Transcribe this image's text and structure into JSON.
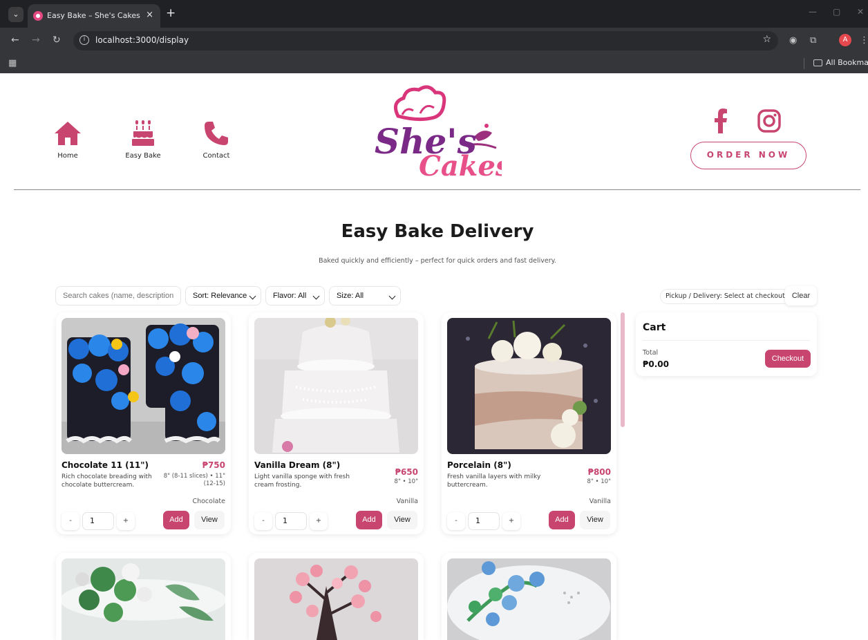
{
  "browser": {
    "tab_title": "Easy Bake – She's Cakes",
    "tab_close": "×",
    "new_tab": "+",
    "url": "localhost:3000/display",
    "profile_initial": "A",
    "bookmarks_label": "All Bookmarks"
  },
  "header": {
    "nav": [
      {
        "label": "Home",
        "icon": "house-icon"
      },
      {
        "label": "Easy Bake",
        "icon": "cake-icon"
      },
      {
        "label": "Contact",
        "icon": "phone-icon"
      }
    ],
    "logo_top": "She's",
    "logo_bottom": "Cakes",
    "order_button": "ORDER NOW",
    "brand_color": "#c8456f"
  },
  "page": {
    "title": "Easy Bake Delivery",
    "subtitle": "Baked quickly and efficiently – perfect for quick orders and fast delivery."
  },
  "controls": {
    "search_placeholder": "Search cakes (name, description",
    "sort_label": "Sort: Relevance",
    "flavor_label": "Flavor: All",
    "size_label": "Size: All",
    "pickup_label": "Pickup / Delivery: Select at checkout",
    "clear_label": "Clear"
  },
  "products": [
    {
      "name": "Chocolate 11 (11\")",
      "price": "₱750",
      "description": "Rich chocolate breading with chocolate buttercream.",
      "sizes": "8\" (8-11 slices) • 11\" (12-15)",
      "flavor": "Chocolate",
      "qty": "1",
      "minus": "-",
      "plus": "+",
      "add_label": "Add",
      "view_label": "View"
    },
    {
      "name": "Vanilla Dream (8\")",
      "price": "₱650",
      "description": "Light vanilla sponge with fresh cream frosting.",
      "sizes": "8\" • 10\"",
      "flavor": "Vanilla",
      "qty": "1",
      "minus": "-",
      "plus": "+",
      "add_label": "Add",
      "view_label": "View"
    },
    {
      "name": "Porcelain (8\")",
      "price": "₱800",
      "description": "Fresh vanilla layers with milky buttercream.",
      "sizes": "8\" • 10\"",
      "flavor": "Vanilla",
      "qty": "1",
      "minus": "-",
      "plus": "+",
      "add_label": "Add",
      "view_label": "View"
    }
  ],
  "cart": {
    "title": "Cart",
    "total_label": "Total",
    "total_value": "₱0.00",
    "checkout_label": "Checkout"
  }
}
